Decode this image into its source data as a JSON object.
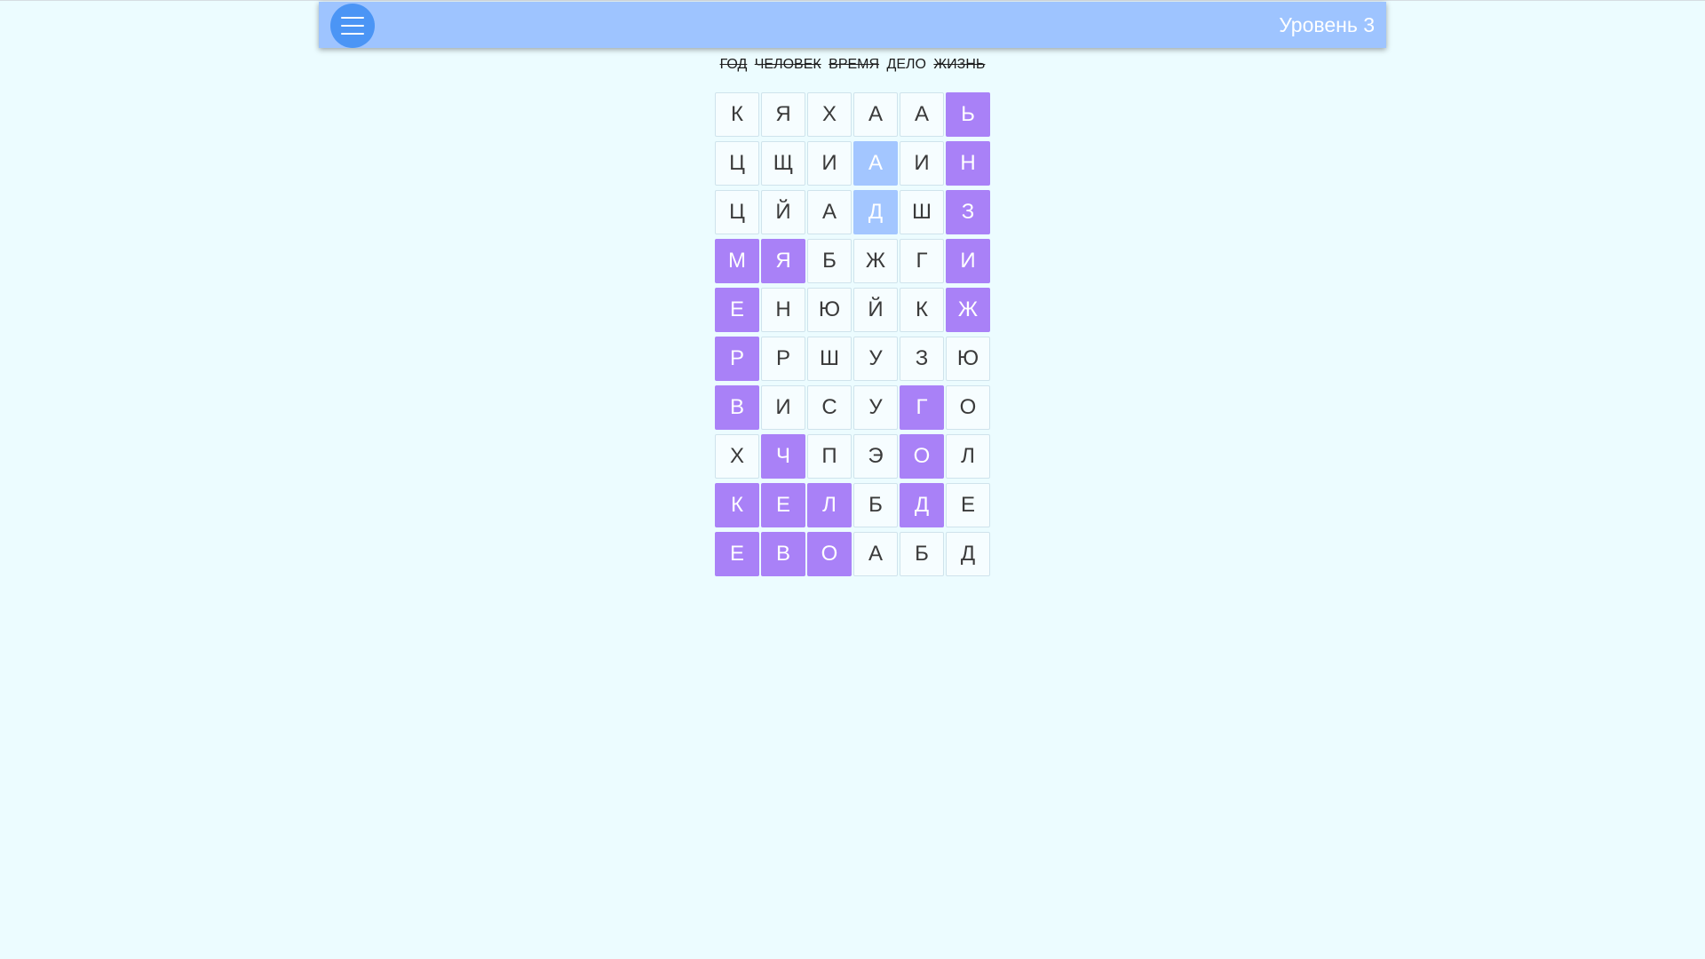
{
  "header": {
    "menu_icon": "hamburger-menu-icon",
    "level_label": "Уровень 3",
    "colors": {
      "bar": "#9ec4ff",
      "menu_button": "#4b95f5"
    }
  },
  "words": [
    {
      "text": "ГОД",
      "found": true
    },
    {
      "text": "ЧЕЛОВЕК",
      "found": true
    },
    {
      "text": "ВРЕМЯ",
      "found": true
    },
    {
      "text": "ДЕЛО",
      "found": false
    },
    {
      "text": "ЖИЗНЬ",
      "found": true
    }
  ],
  "grid": {
    "rows": [
      [
        "К",
        "Я",
        "Х",
        "А",
        "А",
        "Ь"
      ],
      [
        "Ц",
        "Щ",
        "И",
        "А",
        "И",
        "Н"
      ],
      [
        "Ц",
        "Й",
        "А",
        "Д",
        "Ш",
        "З"
      ],
      [
        "М",
        "Я",
        "Б",
        "Ж",
        "Г",
        "И"
      ],
      [
        "Е",
        "Н",
        "Ю",
        "Й",
        "К",
        "Ж"
      ],
      [
        "Р",
        "Р",
        "Ш",
        "У",
        "З",
        "Ю"
      ],
      [
        "В",
        "И",
        "С",
        "У",
        "Г",
        "О"
      ],
      [
        "Х",
        "Ч",
        "П",
        "Э",
        "О",
        "Л"
      ],
      [
        "К",
        "Е",
        "Л",
        "Б",
        "Д",
        "Е"
      ],
      [
        "Е",
        "В",
        "О",
        "А",
        "Б",
        "Д"
      ]
    ],
    "states": [
      [
        "",
        "",
        "",
        "",
        "",
        "found"
      ],
      [
        "",
        "",
        "",
        "selected",
        "",
        "found"
      ],
      [
        "",
        "",
        "",
        "selected",
        "",
        "found"
      ],
      [
        "found",
        "found",
        "",
        "",
        "",
        "found"
      ],
      [
        "found",
        "",
        "",
        "",
        "",
        "found"
      ],
      [
        "found",
        "",
        "",
        "",
        "",
        ""
      ],
      [
        "found",
        "",
        "",
        "",
        "found",
        ""
      ],
      [
        "",
        "found",
        "",
        "",
        "found",
        ""
      ],
      [
        "found",
        "found",
        "found",
        "",
        "found",
        ""
      ],
      [
        "found",
        "found",
        "found",
        "",
        "",
        ""
      ]
    ],
    "colors": {
      "found": "#a981f7",
      "selected": "#a3c6ff",
      "empty": "#f6fdff"
    }
  }
}
